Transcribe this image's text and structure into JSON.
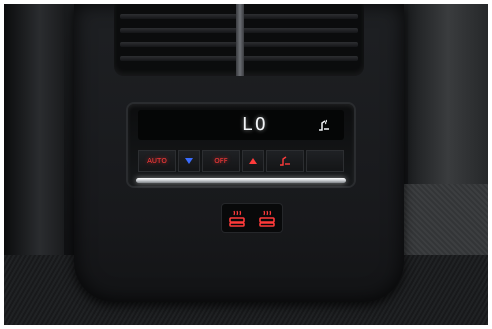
{
  "climate_panel": {
    "temperature_display": "LO",
    "auto_label": "AUTO",
    "off_label": "OFF"
  },
  "icons": {
    "temp_down": "triangle-down-icon",
    "temp_up": "triangle-up-icon",
    "seat_heat_display": "seat-heat-icon",
    "seat_heat_left": "seat-heat-icon",
    "seat_heat_right": "seat-heat-icon"
  },
  "colors": {
    "indicator_red": "#ff3b3b",
    "arrow_blue": "#3a6cff",
    "display_white": "#f2f4f6"
  }
}
